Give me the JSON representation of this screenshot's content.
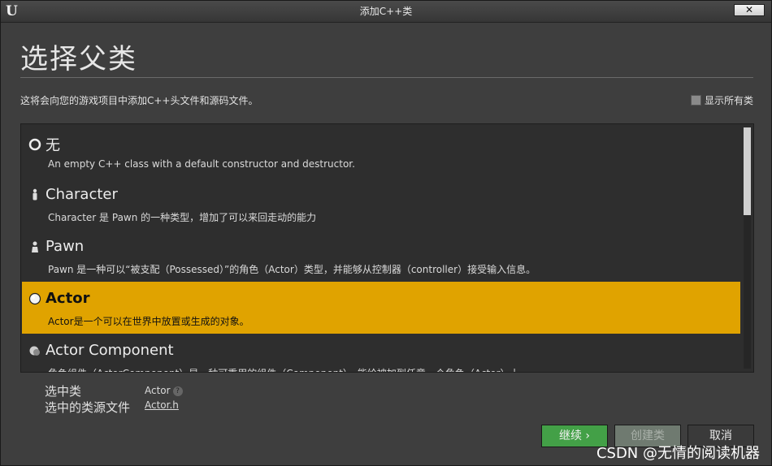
{
  "window": {
    "title": "添加C++类",
    "close_label": "✕"
  },
  "heading": "选择父类",
  "description": "这将会向您的游戏项目中添加C++头文件和源码文件。",
  "show_all_label": "显示所有类",
  "classes": [
    {
      "title": "无",
      "desc": "An empty C++ class with a default constructor and destructor.",
      "icon": "empty-circle-icon",
      "selected": false
    },
    {
      "title": "Character",
      "desc": "Character 是 Pawn 的一种类型，增加了可以来回走动的能力",
      "icon": "character-figure-icon",
      "selected": false
    },
    {
      "title": "Pawn",
      "desc": "Pawn 是一种可以“被支配（Possessed）”的角色（Actor）类型，并能够从控制器（controller）接受输入信息。",
      "icon": "pawn-figure-icon",
      "selected": false
    },
    {
      "title": "Actor",
      "desc": "Actor是一个可以在世界中放置或生成的对象。",
      "icon": "actor-sphere-icon",
      "selected": true
    },
    {
      "title": "Actor Component",
      "desc": "角色组件（ActorComponent）是一种可重用的组件（Component），能给被加到任意一个角色（Actor）上",
      "icon": "component-icon",
      "selected": false
    }
  ],
  "selected_info": {
    "class_label": "选中类",
    "class_value": "Actor",
    "file_label": "选中的类源文件",
    "file_value": "Actor.h"
  },
  "buttons": {
    "continue": "继续",
    "create": "创建类",
    "cancel": "取消"
  },
  "watermark": "CSDN @无情的阅读机器",
  "colors": {
    "selected": "#e0a300",
    "continue_btn": "#43a047"
  }
}
